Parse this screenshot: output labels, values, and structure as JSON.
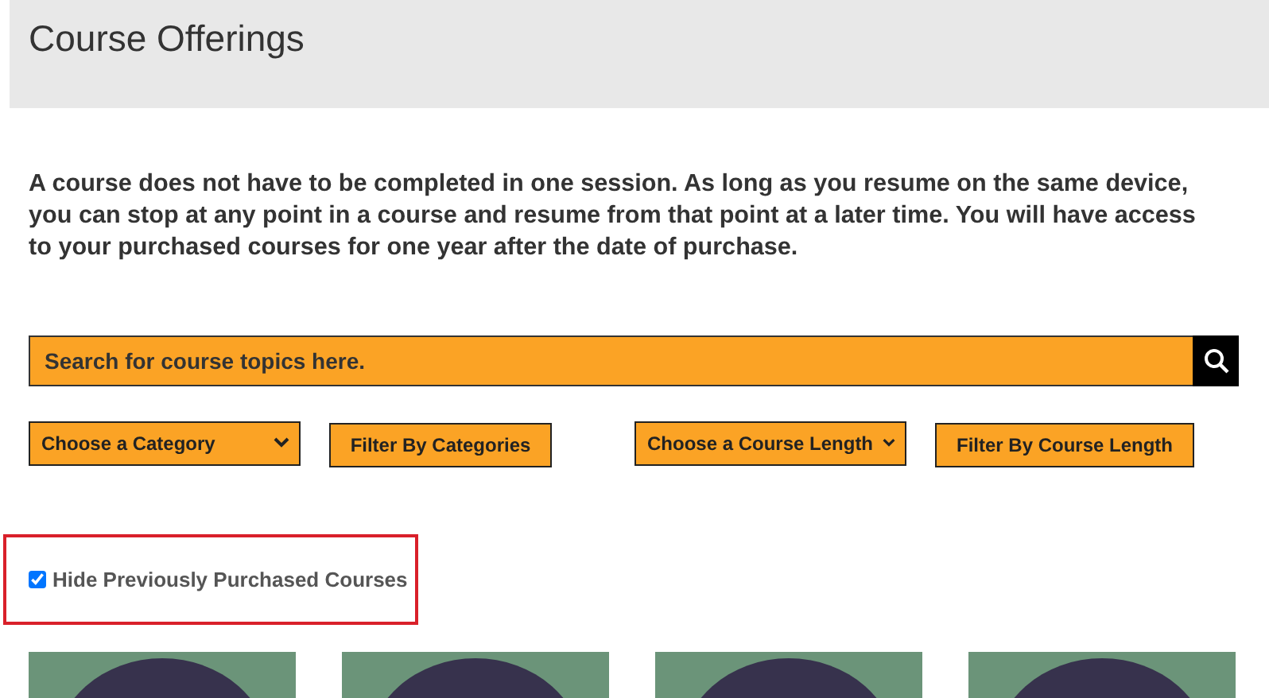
{
  "header": {
    "title": "Course Offerings"
  },
  "intro": "A course does not have to be completed in one session. As long as you resume on the same device, you can stop at any point in a course and resume from that point at a later time. You will have access to your purchased courses for one year after the date of purchase.",
  "search": {
    "placeholder": "Search for course topics here."
  },
  "filters": [
    {
      "kind": "select",
      "value": "Choose a Category"
    },
    {
      "kind": "button",
      "label": "Filter By Categories"
    },
    {
      "kind": "select",
      "value": "Choose a Course Length"
    },
    {
      "kind": "button",
      "label": "Filter By Course Length"
    }
  ],
  "hide_purchased": {
    "label": "Hide Previously Purchased Courses",
    "checked": true
  },
  "courses": [
    {
      "kind": "circle"
    },
    {
      "kind": "circle"
    },
    {
      "kind": "circle"
    },
    {
      "kind": "circle"
    }
  ]
}
